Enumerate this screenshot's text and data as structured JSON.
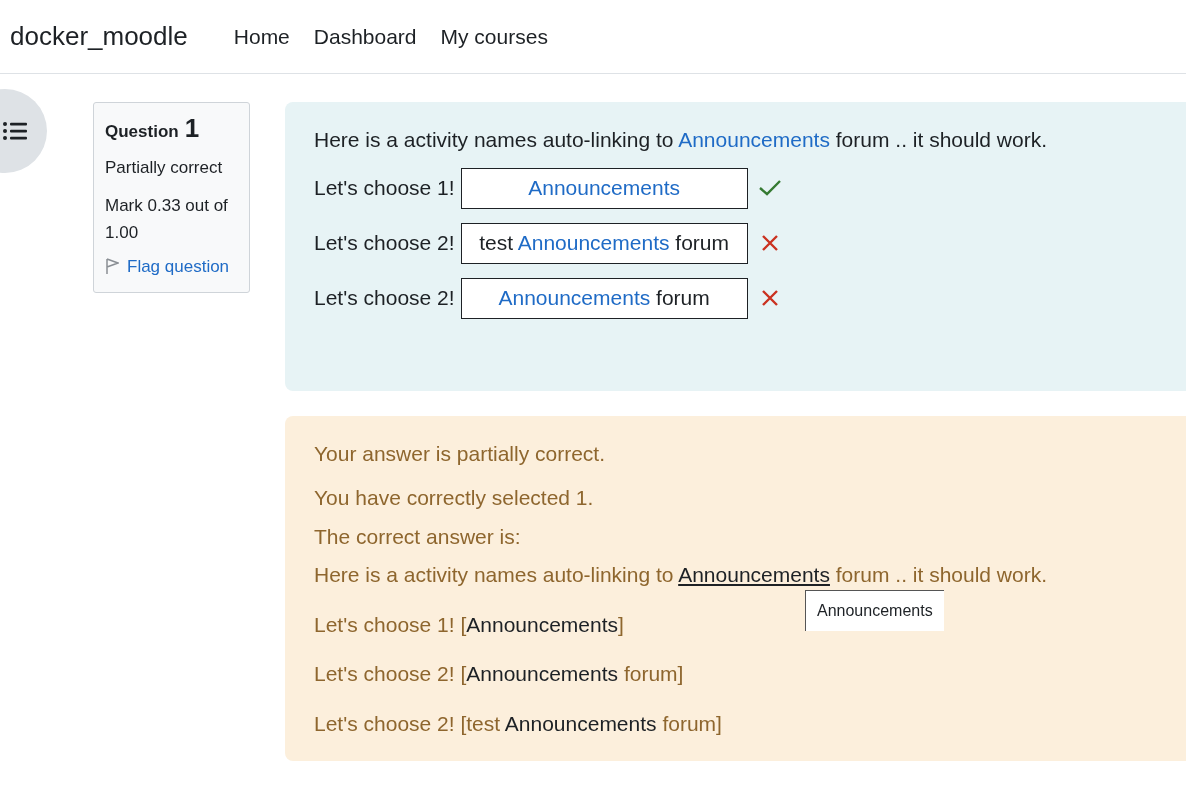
{
  "brand": "docker_moodle",
  "nav": [
    {
      "label": "Home"
    },
    {
      "label": "Dashboard"
    },
    {
      "label": "My courses"
    }
  ],
  "question_info": {
    "title": "Question",
    "number": "1",
    "state": "Partially correct",
    "mark": "Mark 0.33 out of 1.00",
    "flag": "Flag question"
  },
  "question": {
    "intro": [
      {
        "kind": "plain",
        "text": "Here is a activity names auto-linking to "
      },
      {
        "kind": "link",
        "text": "Announcements"
      },
      {
        "kind": "plain",
        "text": " forum .. it should work."
      }
    ],
    "items": [
      {
        "label": "Let's choose 1!",
        "correct": true,
        "answer": [
          {
            "kind": "link",
            "text": "Announcements"
          }
        ]
      },
      {
        "label": "Let's choose 2!",
        "correct": false,
        "answer": [
          {
            "kind": "plain",
            "text": "test "
          },
          {
            "kind": "link",
            "text": "Announcements"
          },
          {
            "kind": "plain",
            "text": " forum"
          }
        ]
      },
      {
        "label": "Let's choose 2!",
        "correct": false,
        "answer": [
          {
            "kind": "link",
            "text": "Announcements"
          },
          {
            "kind": "plain",
            "text": " forum"
          }
        ]
      }
    ]
  },
  "feedback": {
    "summary": "Your answer is partially correct.",
    "selected": "You have correctly selected 1.",
    "correct_label": "The correct answer is:",
    "correct_text": [
      {
        "kind": "plain",
        "text": "Here is a activity names auto-linking to "
      },
      {
        "kind": "link",
        "text": "Announcements"
      },
      {
        "kind": "plain",
        "text": " forum .. it should work."
      }
    ],
    "answers": [
      [
        {
          "kind": "plain",
          "text": "Let's choose 1! ["
        },
        {
          "kind": "dark",
          "text": "Announcements"
        },
        {
          "kind": "plain",
          "text": "]"
        }
      ],
      [
        {
          "kind": "plain",
          "text": "Let's choose 2! ["
        },
        {
          "kind": "dark",
          "text": "Announcements"
        },
        {
          "kind": "plain",
          "text": " forum]"
        }
      ],
      [
        {
          "kind": "plain",
          "text": "Let's choose 2! [test "
        },
        {
          "kind": "dark",
          "text": "Announcements"
        },
        {
          "kind": "plain",
          "text": " forum]"
        }
      ]
    ]
  },
  "tooltip": "Announcements"
}
